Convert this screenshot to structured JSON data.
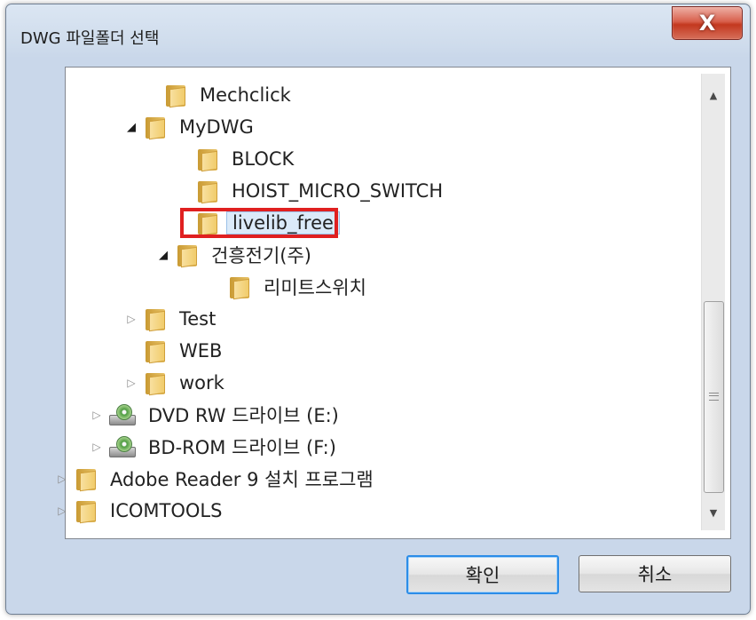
{
  "window": {
    "title": "DWG 파일폴더 선택",
    "close_label": "X"
  },
  "tree": {
    "items": [
      {
        "label": "Mechclick",
        "toggle": "",
        "icon": "folder-icon"
      },
      {
        "label": "MyDWG",
        "toggle": "◢",
        "icon": "folder-icon"
      },
      {
        "label": "BLOCK",
        "toggle": "",
        "icon": "folder-icon"
      },
      {
        "label": "HOIST_MICRO_SWITCH",
        "toggle": "",
        "icon": "folder-icon"
      },
      {
        "label": "livelib_free",
        "toggle": "",
        "icon": "folder-icon",
        "selected": true
      },
      {
        "label": "건흥전기(주)",
        "toggle": "◢",
        "icon": "folder-icon"
      },
      {
        "label": "리미트스위치",
        "toggle": "",
        "icon": "folder-icon"
      },
      {
        "label": "Test",
        "toggle": "▷",
        "icon": "folder-icon"
      },
      {
        "label": "WEB",
        "toggle": "",
        "icon": "folder-icon"
      },
      {
        "label": "work",
        "toggle": "▷",
        "icon": "folder-icon"
      },
      {
        "label": "DVD RW 드라이브 (E:)",
        "toggle": "▷",
        "icon": "dvd-drive-icon"
      },
      {
        "label": "BD-ROM 드라이브 (F:)",
        "toggle": "▷",
        "icon": "dvd-drive-icon"
      },
      {
        "label": "Adobe Reader 9 설치 프로그램",
        "toggle": "▷",
        "icon": "folder-icon"
      },
      {
        "label": "ICOMTOOLS",
        "toggle": "▷",
        "icon": "folder-icon"
      }
    ]
  },
  "scrollbar": {
    "up_arrow": "▲",
    "down_arrow": "▼"
  },
  "buttons": {
    "ok_label": "확인",
    "cancel_label": "취소"
  },
  "colors": {
    "selection_highlight": "#e02020",
    "default_button_border": "#2c8de8"
  }
}
